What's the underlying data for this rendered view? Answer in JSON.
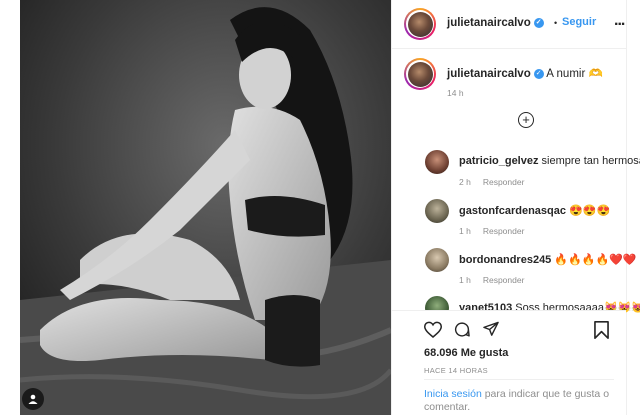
{
  "post": {
    "username": "julietanaircalvo",
    "follow_label": "Seguir",
    "separator": "•",
    "more_label": "...",
    "caption_text": "A numir",
    "caption_emoji": "🫶",
    "caption_time": "14 h"
  },
  "comments": [
    {
      "user": "patricio_gelvez",
      "text": "siempre tan hermosa",
      "time": "2 h",
      "reply": "Responder"
    },
    {
      "user": "gastonfcardenasqac",
      "text": "😍😍😍",
      "time": "1 h",
      "reply": "Responder"
    },
    {
      "user": "bordonandres245",
      "text": "🔥🔥🔥🔥❤️❤️",
      "time": "1 h",
      "reply": "Responder"
    },
    {
      "user": "yanet5103",
      "text": "Soss hermosaaaa😻😻😻",
      "time": "",
      "reply": ""
    }
  ],
  "footer": {
    "likes": "68.096 Me gusta",
    "ago": "HACE 14 HORAS",
    "login_link": "Inicia sesión",
    "login_rest": " para indicar que te gusta o comentar."
  },
  "colors": {
    "accent": "#3897f0",
    "text": "#262626",
    "muted": "#8e8e8e"
  },
  "icons": [
    "heart-icon",
    "comment-icon",
    "share-icon",
    "bookmark-icon",
    "add-comment-icon",
    "verified-icon",
    "tagged-user-icon"
  ]
}
